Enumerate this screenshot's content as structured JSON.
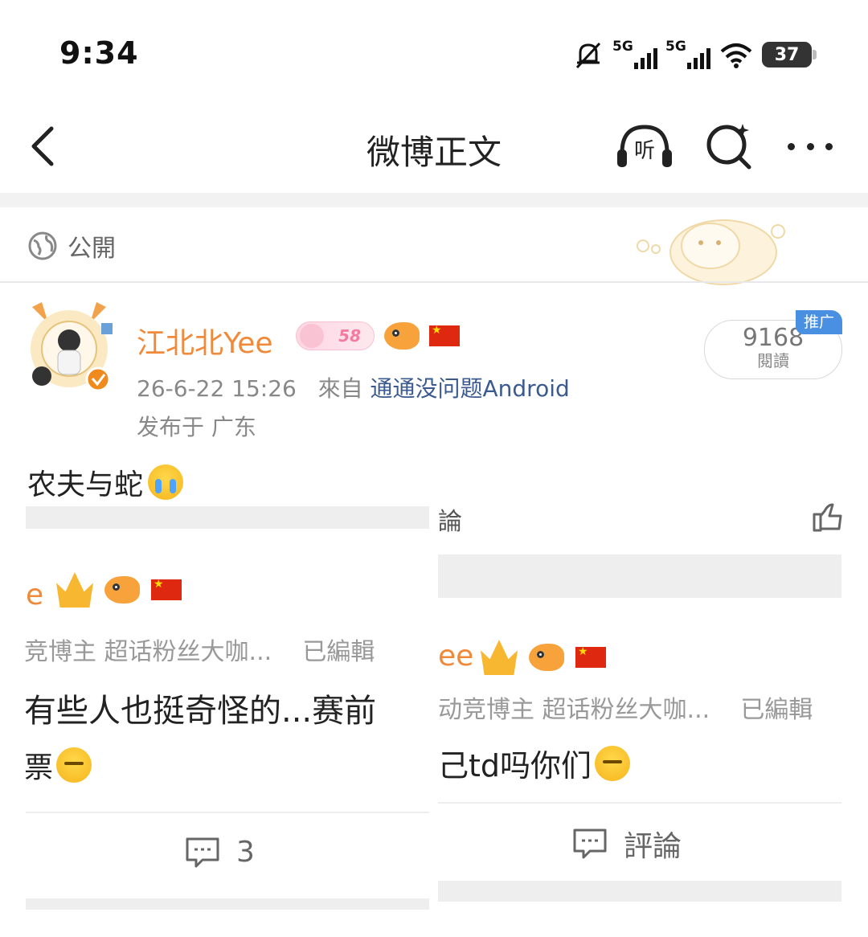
{
  "status_bar": {
    "time": "9:34",
    "signal_1": "5G",
    "signal_2": "5G",
    "battery": "37"
  },
  "header": {
    "title": "微博正文",
    "listen_label": "听"
  },
  "post": {
    "visibility": "公開",
    "author_name": "江北北Yee",
    "level_badge": "58",
    "timestamp": "26-6-22 15:26",
    "source_prefix": "來自",
    "source_app": "通通没问题Android",
    "location": "发布于 广东",
    "read_count": "9168",
    "read_label": "閱讀",
    "promo_tag": "推广",
    "text": "农夫与蛇"
  },
  "left_card": {
    "name_fragment": "e",
    "tags": "竞博主 超话粉丝大咖...",
    "edited": "已編輯",
    "body_line1": "有些人也挺奇怪的...赛前  ",
    "body_line2": "票",
    "comment_count": "3"
  },
  "right_card": {
    "top_label": "論",
    "name_fragment": "ee",
    "tags": "动竞博主 超话粉丝大咖...",
    "edited": "已編輯",
    "body": "己td吗你们",
    "comment_label": "評論"
  },
  "colors": {
    "accent_name": "#f08a3a",
    "source_link": "#3b5a8f",
    "promo": "#4a90e2"
  },
  "icons": [
    "back-icon",
    "listen-icon",
    "search-icon",
    "more-icon",
    "globe-icon",
    "comment-icon",
    "like-icon"
  ]
}
